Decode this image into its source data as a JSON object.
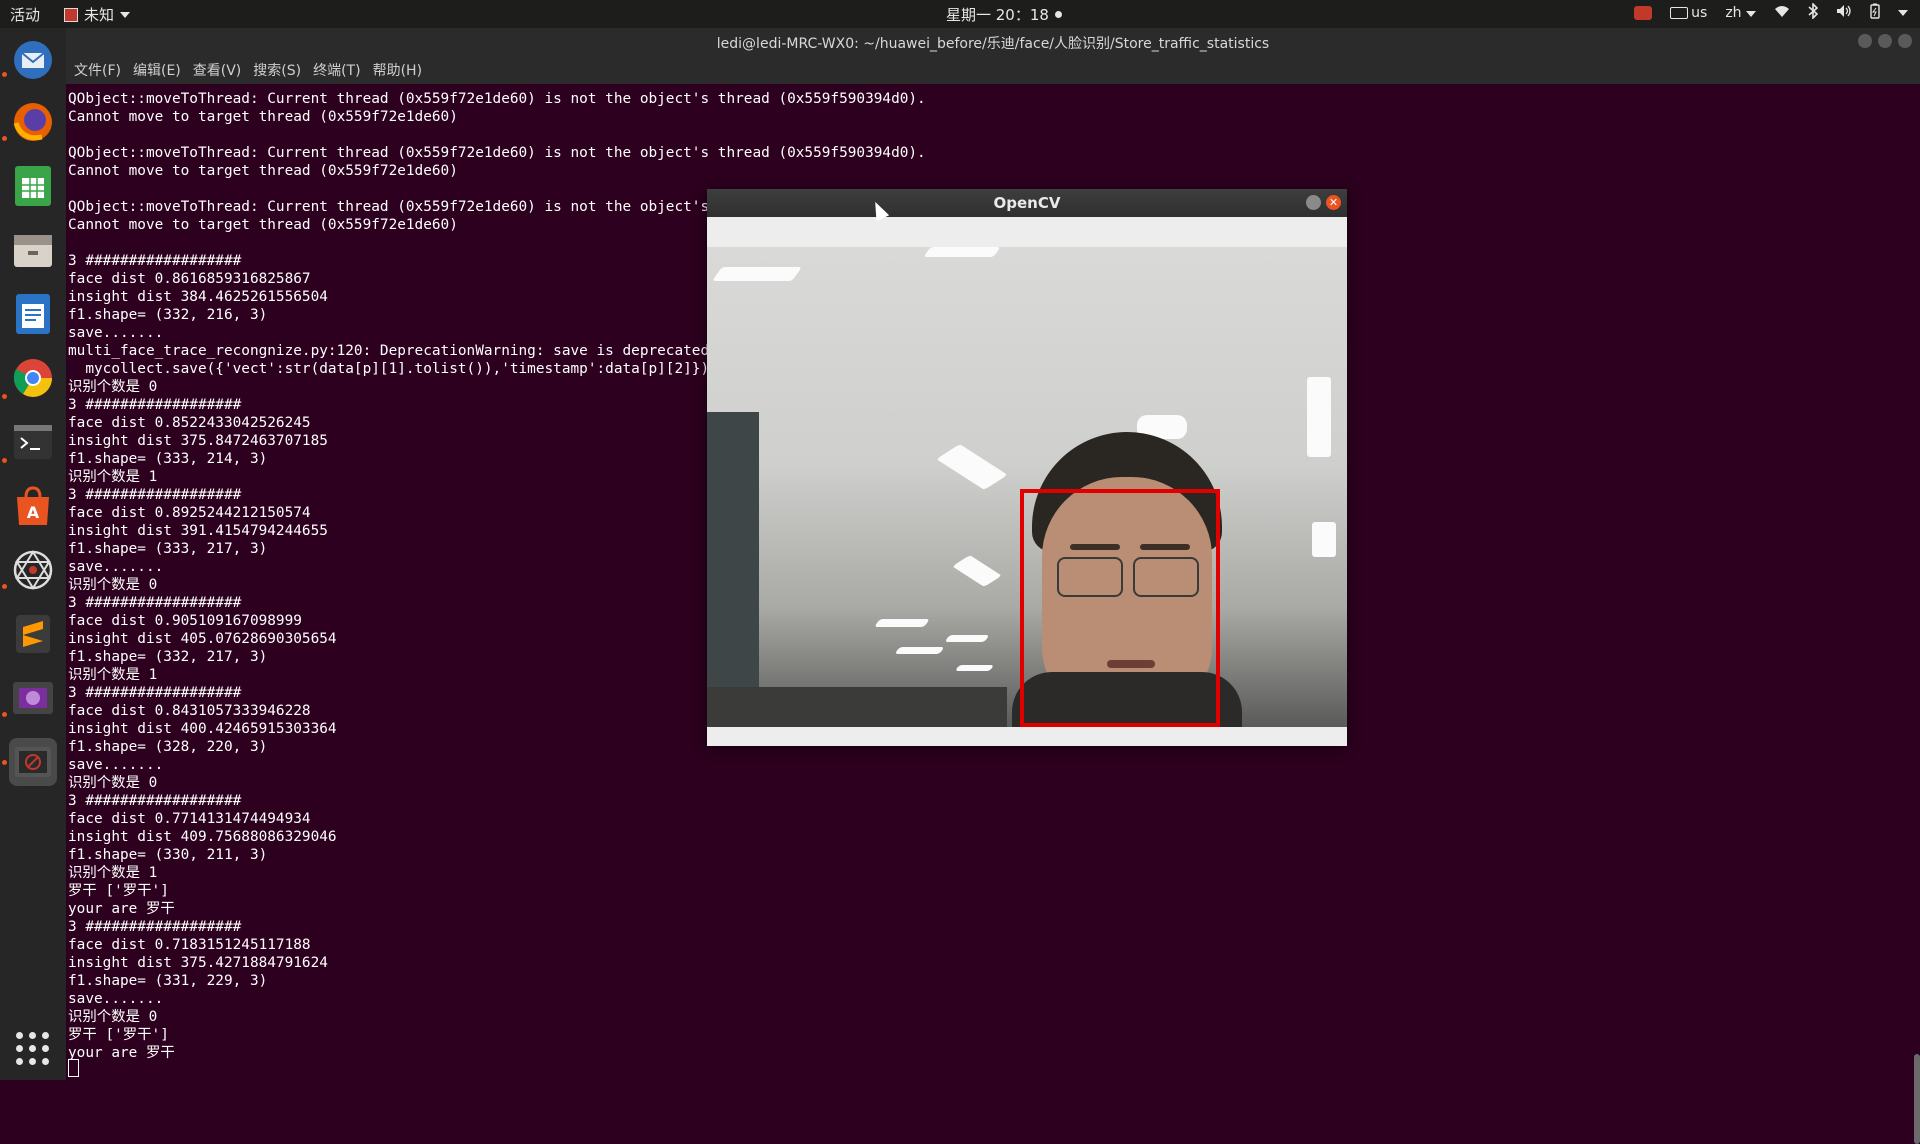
{
  "topbar": {
    "activities": "活动",
    "app_menu": "未知",
    "clock": "星期一 20：18",
    "keyboard": "us",
    "input_method": "zh"
  },
  "terminal": {
    "window_title": "ledi@ledi-MRC-WX0: ~/huawei_before/乐迪/face/人脸识别/Store_traffic_statistics",
    "menu": [
      "文件(F)",
      "编辑(E)",
      "查看(V)",
      "搜索(S)",
      "终端(T)",
      "帮助(H)"
    ],
    "output": "QObject::moveToThread: Current thread (0x559f72e1de60) is not the object's thread (0x559f590394d0).\nCannot move to target thread (0x559f72e1de60)\n\nQObject::moveToThread: Current thread (0x559f72e1de60) is not the object's thread (0x559f590394d0).\nCannot move to target thread (0x559f72e1de60)\n\nQObject::moveToThread: Current thread (0x559f72e1de60) is not the object's thread (0x559f590394d0).\nCannot move to target thread (0x559f72e1de60)\n\n3 ##################\nface dist 0.8616859316825867\ninsight dist 384.4625261556504\nf1.shape= (332, 216, 3)\nsave.......\nmulti_face_trace_recongnize.py:120: DeprecationWarning: save is deprecated. Use insert_one or replace_one instead\n  mycollect.save({'vect':str(data[p][1].tolist()),'timestamp':data[p][2]})\n识别个数是 0\n3 ##################\nface dist 0.8522433042526245\ninsight dist 375.8472463707185\nf1.shape= (333, 214, 3)\n识别个数是 1\n3 ##################\nface dist 0.8925244212150574\ninsight dist 391.4154794244655\nf1.shape= (333, 217, 3)\nsave.......\n识别个数是 0\n3 ##################\nface dist 0.905109167098999\ninsight dist 405.07628690305654\nf1.shape= (332, 217, 3)\n识别个数是 1\n3 ##################\nface dist 0.8431057333946228\ninsight dist 400.42465915303364\nf1.shape= (328, 220, 3)\nsave.......\n识别个数是 0\n3 ##################\nface dist 0.7714131474494934\ninsight dist 409.75688086329046\nf1.shape= (330, 211, 3)\n识别个数是 1\n罗干 ['罗干']\nyour are 罗干\n3 ##################\nface dist 0.7183151245117188\ninsight dist 375.4271884791624\nf1.shape= (331, 229, 3)\nsave.......\n识别个数是 0\n罗干 ['罗干']\nyour are 罗干\n"
  },
  "opencv": {
    "title": "OpenCV"
  },
  "colors": {
    "terminal_bg": "#2c001e",
    "detection_box": "#e00000",
    "ubuntu_orange": "#e95420"
  },
  "dock_icons": [
    "thunderbird-icon",
    "firefox-icon",
    "spreadsheet-icon",
    "files-icon",
    "document-icon",
    "chrome-icon",
    "terminal-icon",
    "software-icon",
    "network-icon",
    "sublime-icon",
    "video-icon",
    "app-icon",
    "show-apps-icon"
  ]
}
